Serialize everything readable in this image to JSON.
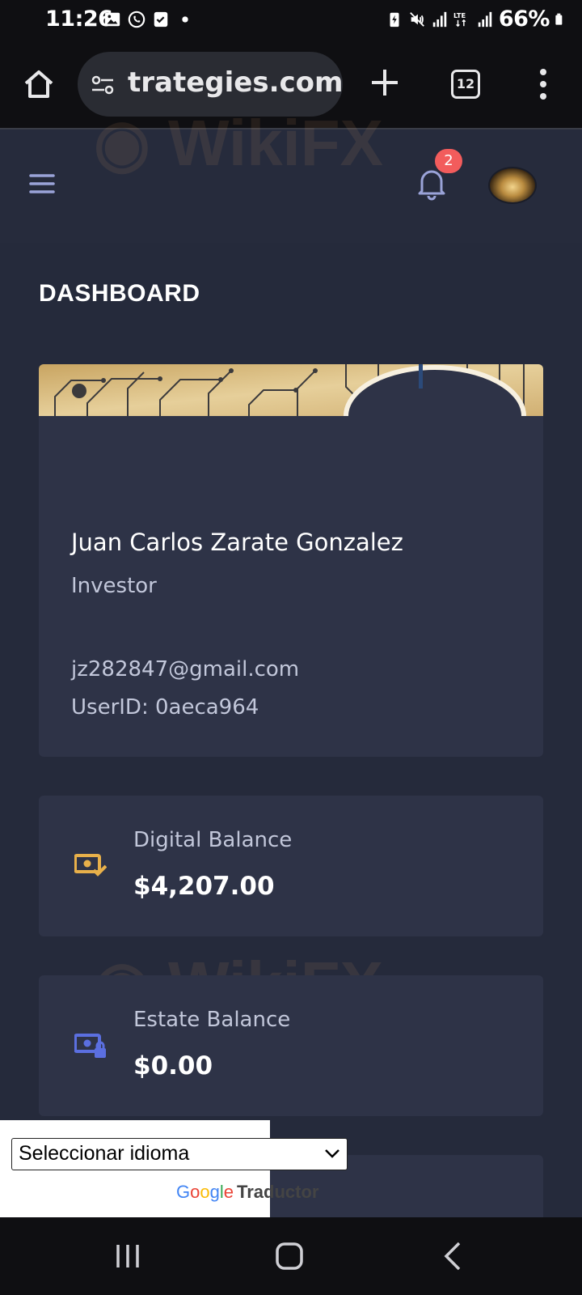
{
  "status_bar": {
    "time": "11:26",
    "battery": "66%",
    "network": "LTE"
  },
  "browser": {
    "url": "trategies.com",
    "tab_count": "12"
  },
  "header": {
    "notification_count": "2"
  },
  "dashboard": {
    "title": "DASHBOARD"
  },
  "profile": {
    "name": "Juan Carlos Zarate Gonzalez",
    "role": "Investor",
    "email": "jz282847@gmail.com",
    "user_id": "UserID: 0aeca964"
  },
  "balances": [
    {
      "label": "Digital Balance",
      "value": "$4,207.00",
      "icon": "money-check-icon",
      "icon_color": "#e8b04a"
    },
    {
      "label": "Estate Balance",
      "value": "$0.00",
      "icon": "money-lock-icon",
      "icon_color": "#5b6fe0"
    }
  ],
  "translate": {
    "select_value": "Seleccionar idioma",
    "google": "Google",
    "translator": "Traductor"
  },
  "colors": {
    "page_bg": "#252a3b",
    "card_bg": "#2e3347",
    "badge": "#f25c5c"
  }
}
